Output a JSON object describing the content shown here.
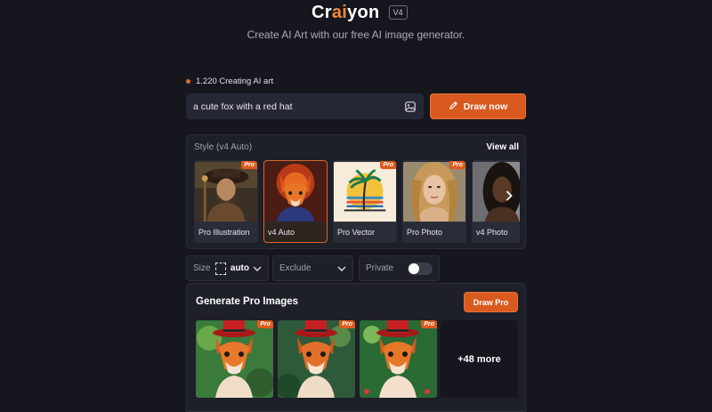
{
  "header": {
    "logo_part1": "Cr",
    "logo_accent": "ai",
    "logo_part2": "yon",
    "version": "V4",
    "tagline": "Create AI Art with our free AI image generator."
  },
  "status": {
    "text": "1.220 Creating AI art"
  },
  "prompt": {
    "value": "a cute fox with a red hat"
  },
  "draw_button": {
    "label": "Draw now"
  },
  "styles": {
    "title": "Style (v4 Auto)",
    "view_all": "View all",
    "items": [
      {
        "label": "Pro Illustration",
        "pro": true,
        "selected": false
      },
      {
        "label": "v4 Auto",
        "pro": false,
        "selected": true
      },
      {
        "label": "Pro Vector",
        "pro": true,
        "selected": false
      },
      {
        "label": "Pro Photo",
        "pro": true,
        "selected": false
      },
      {
        "label": "v4 Photo",
        "pro": false,
        "selected": false
      }
    ],
    "pro_badge": "Pro"
  },
  "options": {
    "size_label": "Size",
    "size_value": "auto",
    "exclude_label": "Exclude",
    "private_label": "Private",
    "private_on": false
  },
  "pro_panel": {
    "title": "Generate Pro Images",
    "button": "Draw Pro",
    "more_text": "+48 more",
    "badge": "Pro"
  },
  "colors": {
    "accent": "#d95a1e",
    "background": "#15161e",
    "panel": "#1d1f29"
  }
}
